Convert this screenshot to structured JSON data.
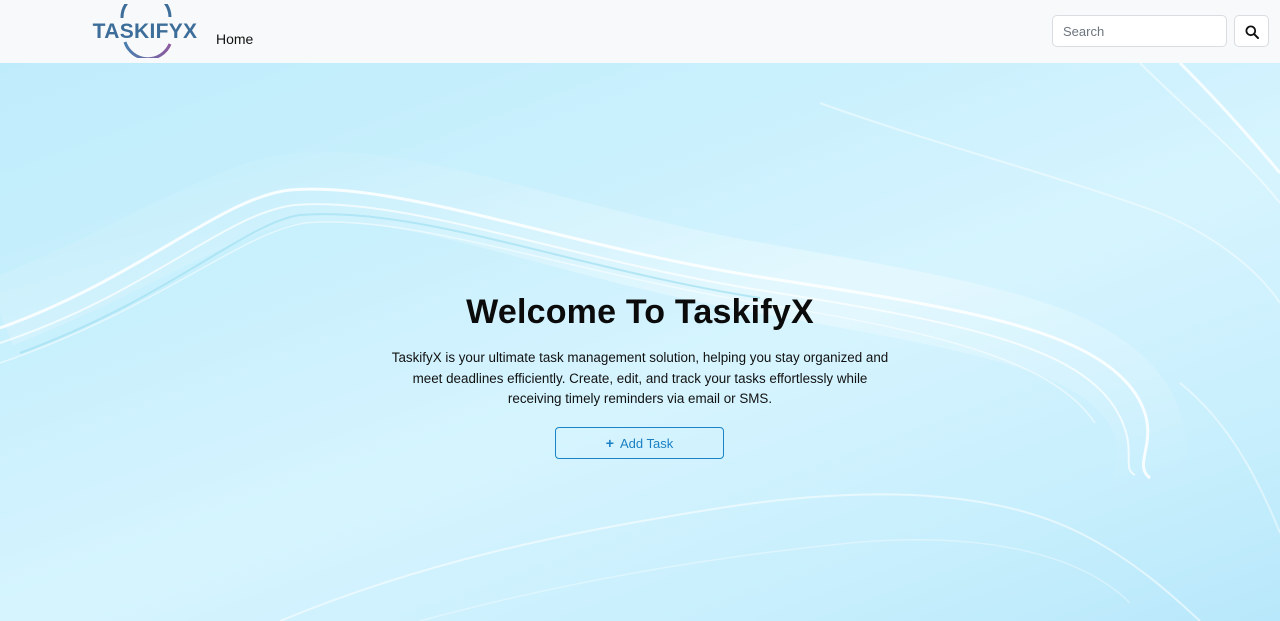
{
  "brand": {
    "logo_text": "TASKIFYX",
    "icon": "taskifyx-logo"
  },
  "nav": {
    "home_label": "Home"
  },
  "search": {
    "placeholder": "Search",
    "value": "",
    "icon": "search-icon"
  },
  "hero": {
    "title": "Welcome To TaskifyX",
    "description": "TaskifyX is your ultimate task management solution, helping you stay organized and meet deadlines efficiently. Create, edit, and track your tasks effortlessly while receiving timely reminders via email or SMS.",
    "add_task_icon": "+",
    "add_task_label": "Add Task"
  },
  "colors": {
    "navbar_bg": "#f8f9fa",
    "hero_bg": "#c9f0fd",
    "accent": "#1a84c6",
    "logo_primary": "#3d6e9a",
    "logo_arc_accent": "#8c5aa0"
  }
}
